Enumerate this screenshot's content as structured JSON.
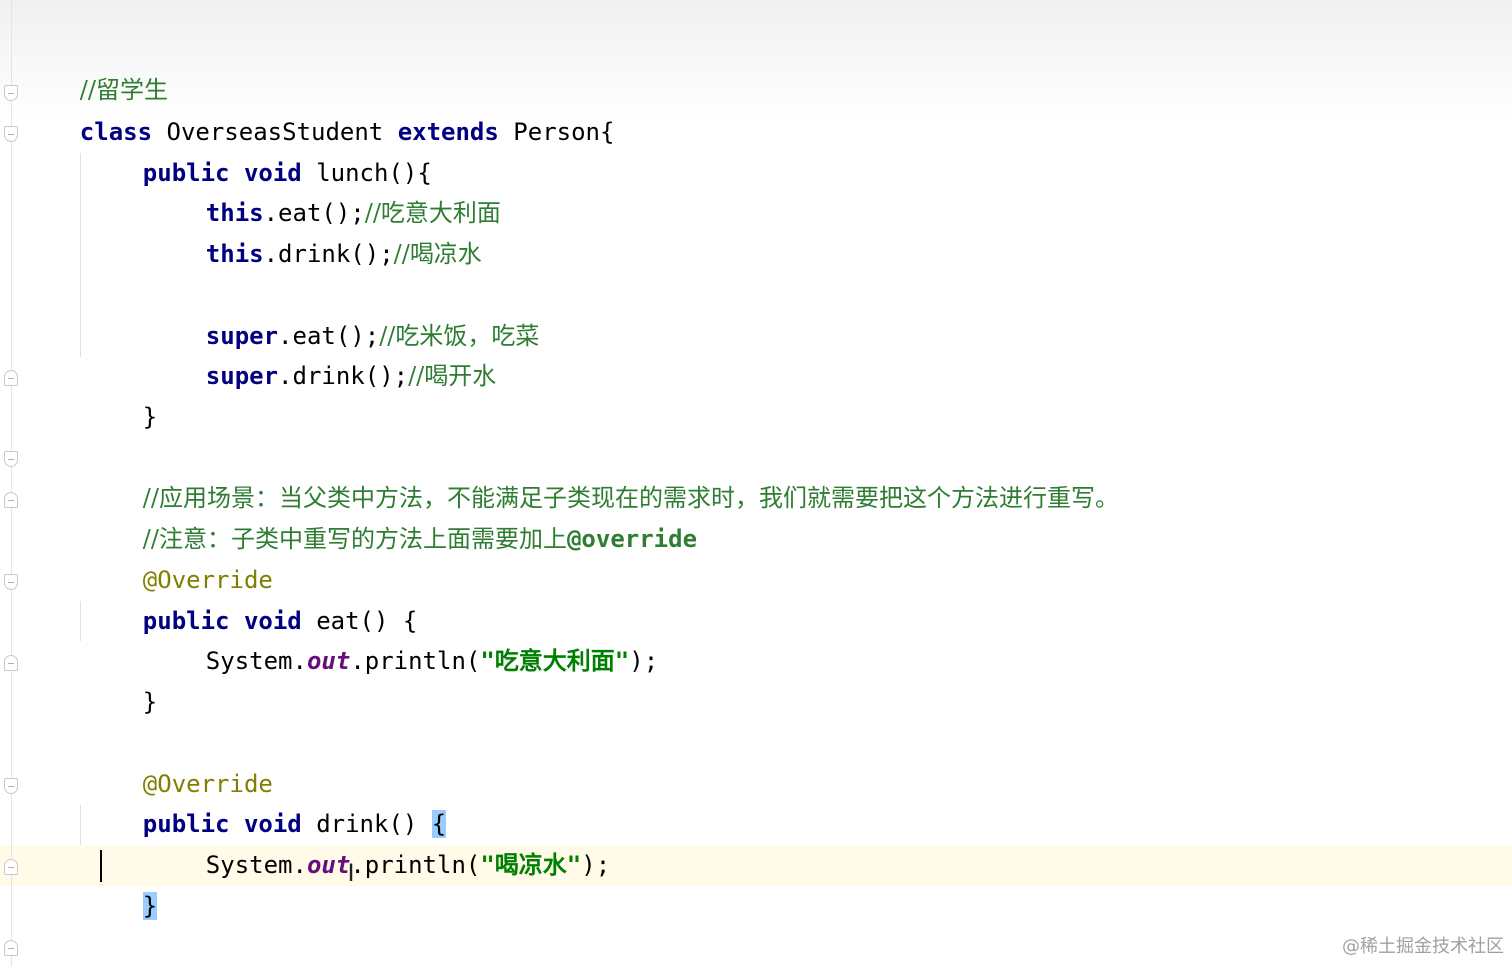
{
  "editor": {
    "watermark": "@稀土掘金技术社区",
    "lines": {
      "l1": {
        "comment": "//留学生"
      },
      "l2": {
        "kw1": "class",
        "t1": " OverseasStudent ",
        "kw2": "extends",
        "t2": " Person{"
      },
      "l3": {
        "kw1": "public",
        "kw2": "void",
        "t1": " lunch(){"
      },
      "l4": {
        "kw": "this",
        "t": ".eat();",
        "comment": "//吃意大利面"
      },
      "l5": {
        "kw": "this",
        "t": ".drink();",
        "comment": "//喝凉水"
      },
      "l6": {
        "kw": "super",
        "t": ".eat();",
        "comment": "//吃米饭，吃菜"
      },
      "l7": {
        "kw": "super",
        "t": ".drink();",
        "comment": "//喝开水"
      },
      "l8": {
        "t": "}"
      },
      "l9": {
        "comment": "//应用场景：当父类中方法，不能满足子类现在的需求时，我们就需要把这个方法进行重写。"
      },
      "l10": {
        "comment": "//注意：子类中重写的方法上面需要加上",
        "code": "@override"
      },
      "l11": {
        "annotation": "@Override"
      },
      "l12": {
        "kw1": "public",
        "kw2": "void",
        "t1": " eat() {"
      },
      "l13": {
        "t1": "System.",
        "field": "out",
        "t2": ".println(",
        "str": "\"吃意大利面\"",
        "t3": ");"
      },
      "l14": {
        "t": "}"
      },
      "l15": {
        "annotation": "@Override"
      },
      "l16": {
        "kw1": "public",
        "kw2": "void",
        "t1": " drink() ",
        "brace": "{"
      },
      "l17": {
        "t1": "System.",
        "field": "out",
        "t2": ".println(",
        "str": "\"喝凉水\"",
        "t3": ");"
      },
      "l18": {
        "brace": "}"
      },
      "l19": {
        "t": "}"
      }
    }
  }
}
